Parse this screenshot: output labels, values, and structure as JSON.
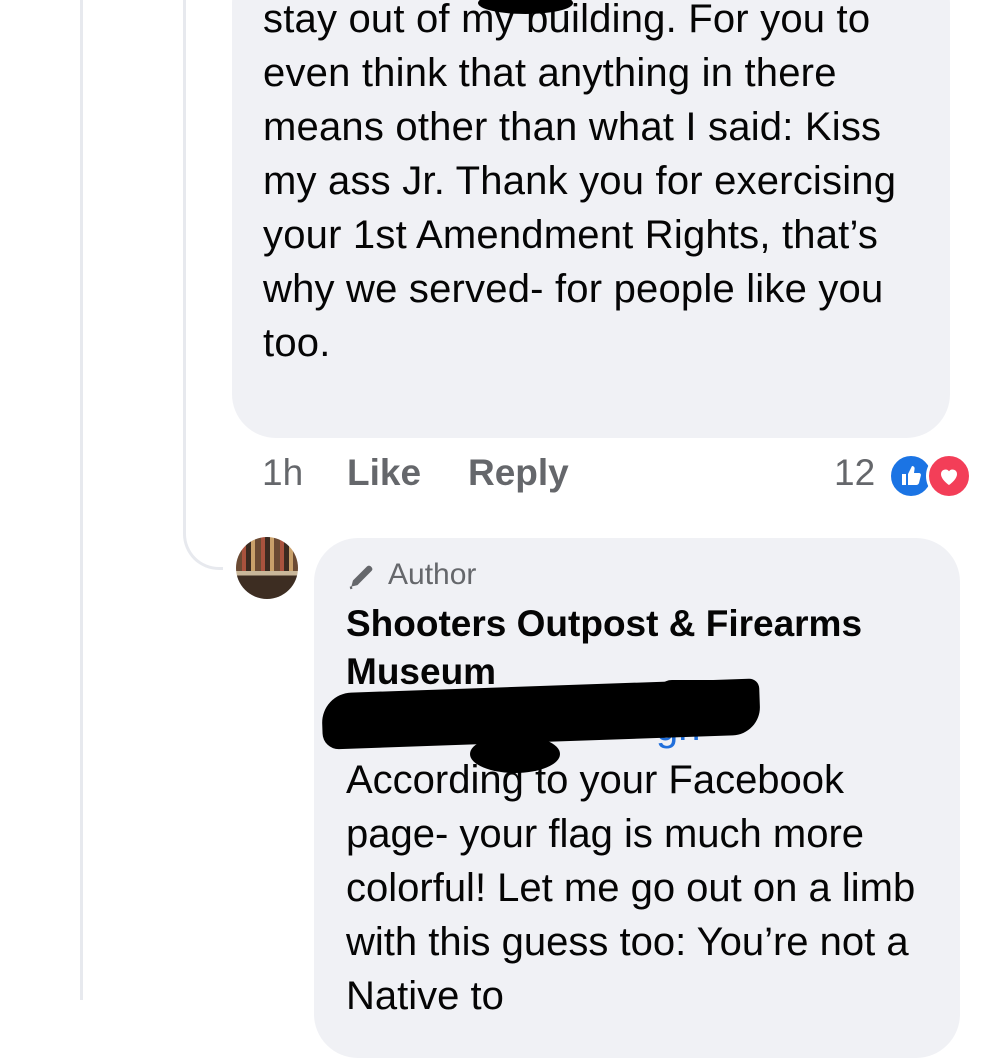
{
  "comment1": {
    "text": "stay out of my building.  For you to even think that anything in there means other than what I said: Kiss my ass Jr.   Thank you for exercising your 1st Amendment Rights, that’s why we served- for people like you too.",
    "time": "1h",
    "like_label": "Like",
    "reply_label": "Reply",
    "reaction_count": "12"
  },
  "reply": {
    "badge": "Author",
    "name": "Shooters Outpost & Firearms Museum",
    "mention_visible_fragment": "gh",
    "mention_separator": "-",
    "text": "According to your Facebook page- your flag is much more colorful!     Let me go out on a limb with this guess too: You’re not a Native to"
  },
  "icons": {
    "like_reaction": "thumbs-up-icon",
    "love_reaction": "heart-icon",
    "author_badge": "pencil-icon"
  },
  "colors": {
    "bubble": "#f0f1f5",
    "meta_text": "#65676b",
    "like_blue": "#1b74e4",
    "love_red": "#f33e58",
    "mention_blue": "#216fdb"
  }
}
